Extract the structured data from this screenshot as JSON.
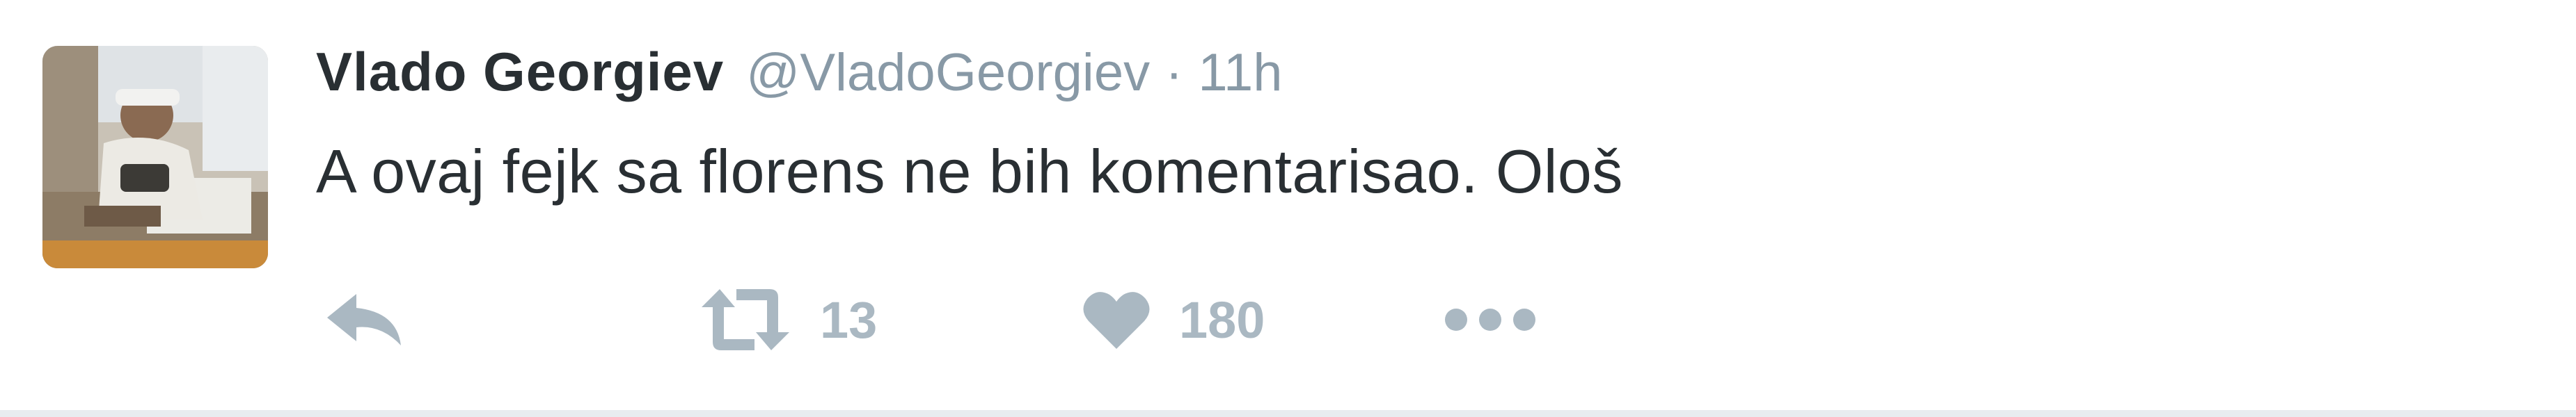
{
  "tweet": {
    "display_name": "Vlado Georgiev",
    "handle": "@VladoGeorgiev",
    "separator": "·",
    "time": "11h",
    "text": "A ovaj fejk sa florens ne bih komentarisao. Ološ",
    "retweet_count": "13",
    "like_count": "180"
  },
  "icons": {
    "reply": "reply-icon",
    "retweet": "retweet-icon",
    "like": "heart-icon",
    "more": "more-icon"
  },
  "colors": {
    "name_text": "#292f33",
    "meta_text": "#8899a6",
    "action_icon": "#aab8c2",
    "divider": "#e8ecef",
    "background": "#ffffff"
  }
}
